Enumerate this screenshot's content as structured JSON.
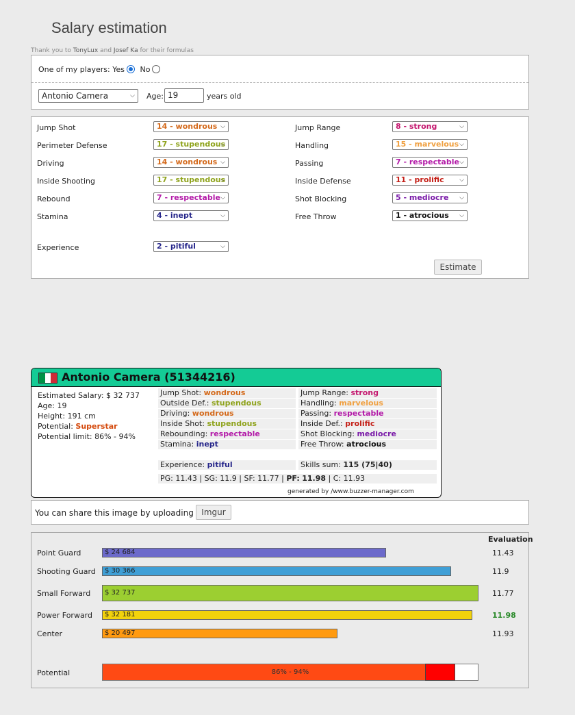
{
  "page": {
    "title": "Salary estimation",
    "credits": {
      "prefix": "Thank you to",
      "name1": "TonyLux",
      "and": "and",
      "name2": "Josef Ka",
      "suffix": "for their formulas"
    }
  },
  "player_form": {
    "one_of_my_players": "One of my players:",
    "yes": "Yes",
    "no": "No",
    "yes_selected": true,
    "player_name": "Antonio Camera",
    "age_label": "Age:",
    "age_value": "19",
    "age_unit": "years old"
  },
  "skills_form": {
    "left": [
      {
        "label": "Jump Shot",
        "value": "14 - wondrous",
        "color": "#d4691a"
      },
      {
        "label": "Perimeter Defense",
        "value": "17 - stupendous",
        "color": "#8fa31c"
      },
      {
        "label": "Driving",
        "value": "14 - wondrous",
        "color": "#d4691a"
      },
      {
        "label": "Inside Shooting",
        "value": "17 - stupendous",
        "color": "#8fa31c"
      },
      {
        "label": "Rebound",
        "value": "7 - respectable",
        "color": "#b31aa8"
      },
      {
        "label": "Stamina",
        "value": "4 - inept",
        "color": "#26268a"
      }
    ],
    "right": [
      {
        "label": "Jump Range",
        "value": "8 - strong",
        "color": "#c4166e"
      },
      {
        "label": "Handling",
        "value": "15 - marvelous",
        "color": "#f0a040"
      },
      {
        "label": "Passing",
        "value": "7 - respectable",
        "color": "#b31aa8"
      },
      {
        "label": "Inside Defense",
        "value": "11 - prolific",
        "color": "#c41e16"
      },
      {
        "label": "Shot Blocking",
        "value": "5 - mediocre",
        "color": "#7a1aa8"
      },
      {
        "label": "Free Throw",
        "value": "1 - atrocious",
        "color": "#111111"
      }
    ],
    "experience": {
      "label": "Experience",
      "value": "2 - pitiful",
      "color": "#26268a"
    },
    "estimate_label": "Estimate"
  },
  "card": {
    "title": "Antonio Camera (51344216)",
    "flag_colors": [
      "#009246",
      "#ffffff",
      "#ce2b37"
    ],
    "info": [
      {
        "label": "Estimated Salary:",
        "value": "$ 32 737",
        "color": "#222222"
      },
      {
        "label": "Age:",
        "value": "19",
        "color": "#222222"
      },
      {
        "label": "Height:",
        "value": "191 cm",
        "color": "#222222"
      },
      {
        "label": "Potential:",
        "value": "Superstar",
        "color": "#d4490c"
      },
      {
        "label": "Potential limit:",
        "value": "86% - 94%",
        "color": "#222222"
      }
    ],
    "skills_left": [
      {
        "label": "Jump Shot:",
        "value": "wondrous",
        "color": "#d4691a"
      },
      {
        "label": "Outside Def.:",
        "value": "stupendous",
        "color": "#8fa31c"
      },
      {
        "label": "Driving:",
        "value": "wondrous",
        "color": "#d4691a"
      },
      {
        "label": "Inside Shot:",
        "value": "stupendous",
        "color": "#8fa31c"
      },
      {
        "label": "Rebounding:",
        "value": "respectable",
        "color": "#b31aa8"
      },
      {
        "label": "Stamina:",
        "value": "inept",
        "color": "#26268a"
      }
    ],
    "skills_right": [
      {
        "label": "Jump Range:",
        "value": "strong",
        "color": "#c4166e"
      },
      {
        "label": "Handling:",
        "value": "marvelous",
        "color": "#f0a040"
      },
      {
        "label": "Passing:",
        "value": "respectable",
        "color": "#b31aa8"
      },
      {
        "label": "Inside Def.:",
        "value": "prolific",
        "color": "#c41e16"
      },
      {
        "label": "Shot Blocking:",
        "value": "mediocre",
        "color": "#7a1aa8"
      },
      {
        "label": "Free Throw:",
        "value": "atrocious",
        "color": "#111111"
      }
    ],
    "experience": {
      "label": "Experience:",
      "value": "pitiful",
      "color": "#26268a"
    },
    "skills_sum": {
      "label": "Skills sum:",
      "value": "115 (75|40)"
    },
    "positions": [
      {
        "label": "PG:",
        "value": "11.43",
        "bold": false
      },
      {
        "label": "SG:",
        "value": "11.9",
        "bold": false
      },
      {
        "label": "SF:",
        "value": "11.77",
        "bold": false
      },
      {
        "label": "PF:",
        "value": "11.98",
        "bold": true
      },
      {
        "label": "C:",
        "value": "11.93",
        "bold": false
      }
    ],
    "generated": "generated by /www.buzzer-manager.com"
  },
  "share": {
    "text": "You can share this image by uploading it on",
    "button": "Imgur"
  },
  "evaluation": {
    "header": "Evaluation",
    "rows": [
      {
        "label": "Point Guard",
        "salary": "$ 24 684",
        "salary_value": 24684,
        "color": "#6c6acb",
        "eval": "11.43",
        "best": false
      },
      {
        "label": "Shooting Guard",
        "salary": "$ 30 366",
        "salary_value": 30366,
        "color": "#3f9fd6",
        "eval": "11.9",
        "best": false
      },
      {
        "label": "Small Forward",
        "salary": "$ 32 737",
        "salary_value": 32737,
        "color": "#9ccf31",
        "eval": "11.77",
        "best": false
      },
      {
        "label": "Power Forward",
        "salary": "$ 32 181",
        "salary_value": 32181,
        "color": "#f2d20c",
        "eval": "11.98",
        "best": true
      },
      {
        "label": "Center",
        "salary": "$ 20 497",
        "salary_value": 20497,
        "color": "#ff9a10",
        "eval": "11.93",
        "best": false
      }
    ],
    "potential": {
      "label": "Potential",
      "text": "86% - 94%",
      "low": 86,
      "high": 94
    }
  }
}
